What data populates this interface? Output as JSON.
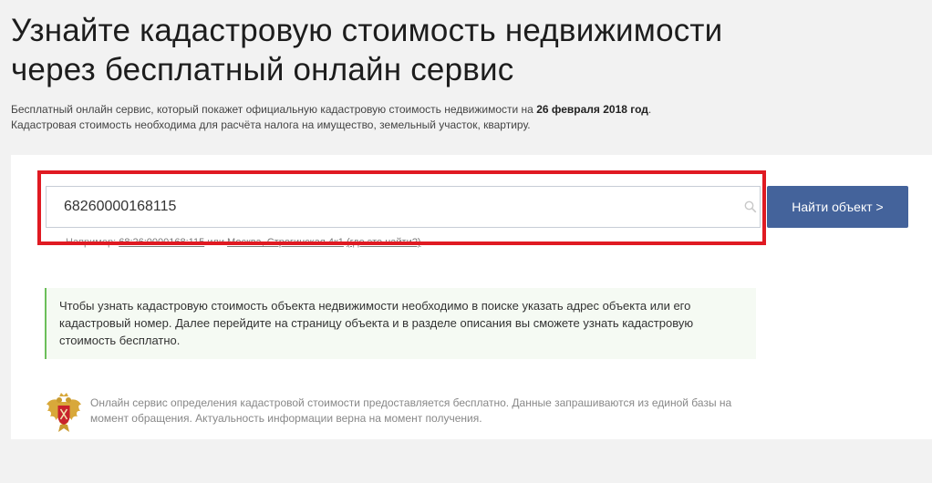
{
  "header": {
    "title_line1": "Узнайте кадастровую стоимость недвижимости",
    "title_line2": "через бесплатный онлайн сервис"
  },
  "description": {
    "line1_text": "Бесплатный онлайн сервис, который покажет официальную кадастровую стоимость недвижимости на",
    "line1_date": "26 февраля 2018 год",
    "line1_end": ".",
    "line2": "Кадастровая стоимость необходима для расчёта налога на имущество, земельный участок, квартиру."
  },
  "search": {
    "value": "68260000168115",
    "button_label": "Найти объект >"
  },
  "example": {
    "prefix": "Например:",
    "number_link": "68:26:0000168:115",
    "or": "или",
    "address_link": "Москва, Строгинская 4к1",
    "where_link": "(где это найти?)"
  },
  "info": {
    "text": "Чтобы узнать кадастровую стоимость объекта недвижимости необходимо в поиске указать адрес объекта или его кадастровый номер. Далее перейдите на страницу объекта и в разделе описания вы сможете узнать кадастровую стоимость бесплатно."
  },
  "footer": {
    "note": "Онлайн сервис определения кадастровой стоимости предоставляется бесплатно. Данные запрашиваются из единой базы на момент обращения. Актуальность информации верна на момент получения."
  },
  "colors": {
    "accent_button": "#44639b",
    "highlight_border": "#e01a22",
    "info_border": "#6cbf5a"
  },
  "icons": {
    "search": "search-icon",
    "emblem": "coat-of-arms-icon"
  }
}
